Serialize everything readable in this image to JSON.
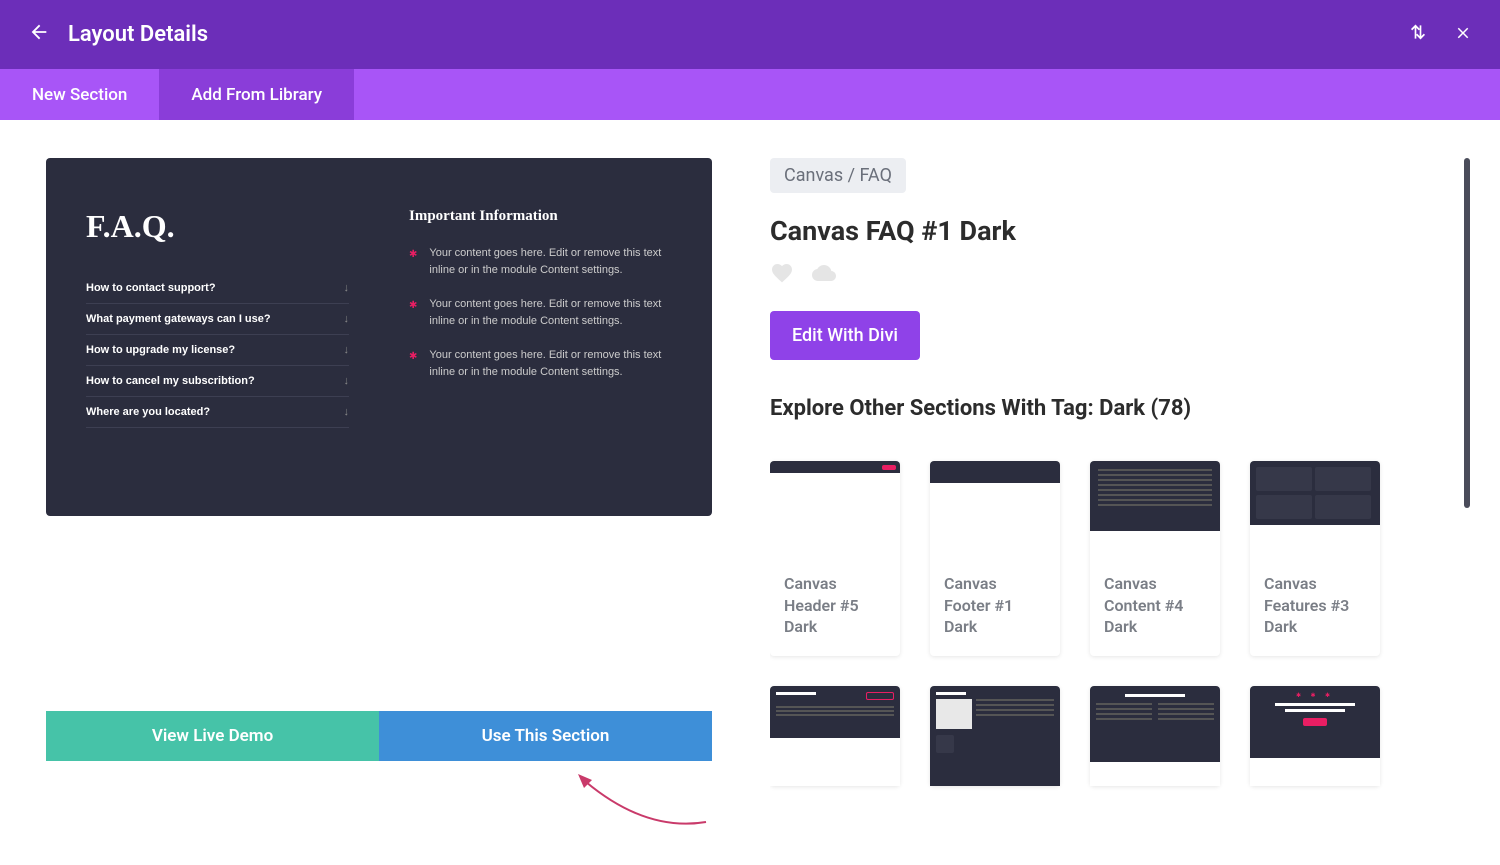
{
  "header": {
    "title": "Layout Details"
  },
  "tabs": {
    "new_section": "New Section",
    "add_from_library": "Add From Library"
  },
  "preview": {
    "faq_title": "F.A.Q.",
    "faq_items": [
      "How to contact support?",
      "What payment gateways can I use?",
      "How to upgrade my license?",
      "How to cancel my subscribtion?",
      "Where are you located?"
    ],
    "info_title": "Important Information",
    "info_text": "Your content goes here. Edit or remove this text inline or in the module Content settings."
  },
  "actions": {
    "view_demo": "View Live Demo",
    "use_section": "Use This Section"
  },
  "details": {
    "breadcrumb": "Canvas / FAQ",
    "title": "Canvas FAQ #1 Dark",
    "edit_label": "Edit With Divi",
    "explore_label": "Explore Other Sections With Tag: Dark (78)"
  },
  "cards": [
    "Canvas Header #5 Dark",
    "Canvas Footer #1 Dark",
    "Canvas Content #4 Dark",
    "Canvas Features #3 Dark"
  ]
}
